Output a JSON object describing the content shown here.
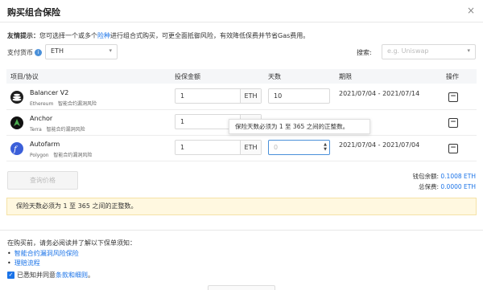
{
  "dialog": {
    "title": "购买组合保险",
    "close_symbol": "×"
  },
  "tip": {
    "label": "友情提示：",
    "text_before": "您可选择一个或多个",
    "link": "险种",
    "text_after": "进行组合式购买，可更全面抵御风险，有效降低保费并节省Gas费用。"
  },
  "payment": {
    "label": "支付货币",
    "info_icon": "i",
    "selected": "ETH"
  },
  "search": {
    "label": "搜索:",
    "placeholder": "e.g. Uniswap"
  },
  "table": {
    "headers": [
      "项目/协议",
      "投保金额",
      "天数",
      "期限",
      "操作"
    ],
    "rows": [
      {
        "name": "Balancer V2",
        "network": "Ethereum",
        "category": "智能合约漏洞风险",
        "amount": "1",
        "unit": "ETH",
        "days": "10",
        "period": "2021/07/04 - 2021/07/14",
        "icon": "balancer-logo",
        "color": "#1e1e1e"
      },
      {
        "name": "Anchor",
        "network": "Terra",
        "category": "智能合约漏洞风险",
        "amount": "1",
        "unit": "ETH",
        "days": "",
        "period": "",
        "icon": "anchor-logo",
        "color": "#2f8a4b"
      },
      {
        "name": "Autofarm",
        "network": "Polygon",
        "category": "智能合约漏洞风险",
        "amount": "1",
        "unit": "ETH",
        "days": "0",
        "period": "2021/07/04 - 2021/07/04",
        "icon": "autofarm-logo",
        "color": "#3b5fd9"
      }
    ]
  },
  "tooltip": "保险天数必须为 1 至 365 之间的正整数。",
  "quote_button": "查询价格",
  "wallet": {
    "balance_label": "钱包余额:",
    "balance_value": "0.1008 ETH",
    "fee_label": "总保费:",
    "fee_value": "0.0000 ETH"
  },
  "warning": "保险天数必须为 1 至 365 之间的正整数。",
  "notice": {
    "intro": "在购买前，请务必阅读并了解以下保单须知：",
    "links": [
      "智能合约漏洞风险保险",
      "理赔流程"
    ],
    "agree_before": "已悉知并同意",
    "agree_link": "条款和细则",
    "agree_after": "。"
  },
  "colors": {
    "accent": "#1a73e8",
    "warning_bg": "#fff8e0"
  }
}
